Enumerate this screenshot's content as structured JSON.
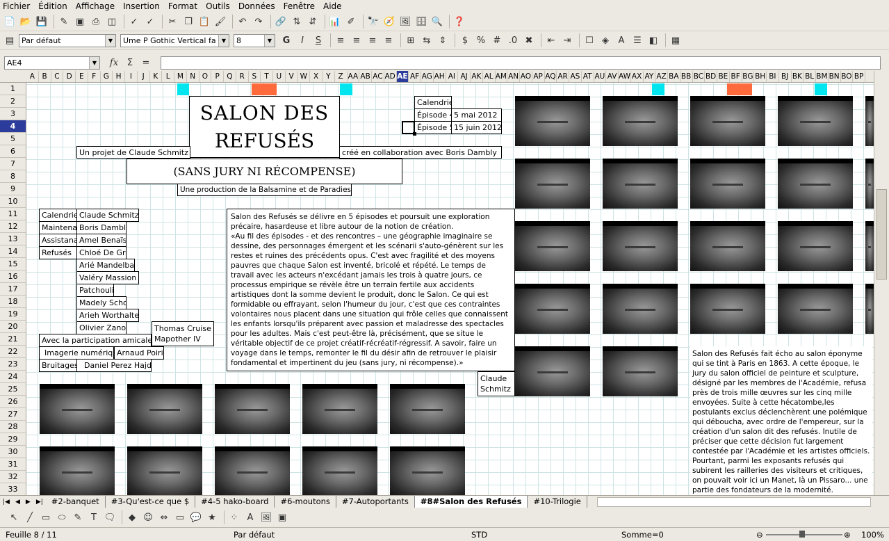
{
  "menu": [
    "Fichier",
    "Édition",
    "Affichage",
    "Insertion",
    "Format",
    "Outils",
    "Données",
    "Fenêtre",
    "Aide"
  ],
  "format_toolbar": {
    "style": "Par défaut",
    "font": "Ume P Gothic Vertical fa",
    "size": "8"
  },
  "formula_bar": {
    "cell_ref": "AE4",
    "content": ""
  },
  "columns": [
    "A",
    "B",
    "C",
    "D",
    "E",
    "F",
    "G",
    "H",
    "I",
    "J",
    "K",
    "L",
    "M",
    "N",
    "O",
    "P",
    "Q",
    "R",
    "S",
    "T",
    "U",
    "V",
    "W",
    "X",
    "Y",
    "Z",
    "AA",
    "AB",
    "AC",
    "AD",
    "AE",
    "AF",
    "AG",
    "AH",
    "AI",
    "AJ",
    "AK",
    "AL",
    "AM",
    "AN",
    "AO",
    "AP",
    "AQ",
    "AR",
    "AS",
    "AT",
    "AU",
    "AV",
    "AW",
    "AX",
    "AY",
    "AZ",
    "BA",
    "BB",
    "BC",
    "BD",
    "BE",
    "BF",
    "BG",
    "BH",
    "BI",
    "BJ",
    "BK",
    "BL",
    "BM",
    "BN",
    "BO",
    "BP"
  ],
  "selected_column": "AE",
  "rows": [
    "1",
    "2",
    "3",
    "4",
    "5",
    "6",
    "7",
    "8",
    "9",
    "10",
    "11",
    "12",
    "13",
    "14",
    "15",
    "16",
    "17",
    "18",
    "19",
    "20",
    "21",
    "22",
    "23",
    "24",
    "25",
    "26",
    "27",
    "28",
    "29",
    "30",
    "31",
    "32",
    "33"
  ],
  "selected_row": "4",
  "sheet": {
    "title_line1": "SALON DES",
    "title_line2": "REFUSÉS",
    "subtitle": "(SANS JURY NI RÉCOMPENSE)",
    "project_by": "Un projet de Claude Schmitz",
    "collab": "créé en collaboration avec Boris Dambly",
    "production": "Une production de la Balsamine et de Paradies.",
    "calendar": {
      "header": "Calendrier",
      "rows": [
        [
          "Épisode 4",
          "5 mai 2012"
        ],
        [
          "Épisode 5",
          "15 juin 2012"
        ]
      ]
    },
    "credits": [
      [
        "Calendrier",
        "Claude Schmitz"
      ],
      [
        "Maintenance",
        "Boris Dambly"
      ],
      [
        "Assistanat",
        "Amel Benaïssa"
      ],
      [
        "Refusés",
        "Chloé De Grom"
      ],
      [
        "",
        "Arié Mandelbaum"
      ],
      [
        "",
        "Valéry Massion"
      ],
      [
        "",
        "Patchouli"
      ],
      [
        "",
        "Madely Schott"
      ],
      [
        "",
        "Arieh Worthalter"
      ],
      [
        "",
        "Olivier Zanotti"
      ]
    ],
    "extra_name_line1": "Thomas Cruise",
    "extra_name_line2": "Mapother IV",
    "participation": "Avec la participation amicale de",
    "imagerie_label": "Imagerie numérique",
    "imagerie_name": "Arnaud Poirier",
    "bruitages_label": "Bruitages",
    "bruitages_name": "Daniel Perez Hajdu",
    "main_text": "Salon des Refusés se délivre en 5 épisodes et poursuit une exploration précaire, hasardeuse et libre autour de la notion de création.\n«Au fil des épisodes - et des rencontres – une géographie imaginaire se dessine, des personnages émergent et les scénarii s'auto-génèrent sur les restes et ruines des précédents opus. C'est avec fragilité et des moyens pauvres que chaque Salon est inventé, bricolé et répété. Le temps de travail avec les acteurs n'excédant jamais les trois à quatre jours, ce processus empirique se révèle être un terrain fertile aux accidents artistiques dont la somme devient le produit, donc le Salon. Ce qui est formidable ou effrayant, selon l'humeur du jour, c'est que ces contraintes volontaires nous placent dans une situation qui frôle celles que connaissent les enfants lorsqu'ils préparent avec passion et maladresse des spectacles pour les adultes. Mais c'est peut-être là, précisément, que se situe le véritable objectif de ce projet créatif-récréatif-régressif. A savoir, faire un voyage dans le temps, remonter le fil du désir afin de retrouver le plaisir fondamental et impertinent du jeu (sans jury, ni récompense).»",
    "signature_line1": "Claude",
    "signature_line2": "Schmitz",
    "side_text": "Salon des Refusés fait écho au salon éponyme qui se tint à Paris en 1863. A cette époque, le jury du salon officiel de peinture et sculpture, désigné par les membres de l'Académie, refusa près de trois mille œuvres sur les cinq mille envoyées. Suite à cette hécatombe,les postulants exclus déclenchèrent une polémique qui déboucha, avec ordre de l'empereur, sur la création d'un salon dit des refusés. Inutile de préciser que cette décision fut largement contestée par l'Académie et les artistes officiels. Pourtant, parmi les exposants refusés qui subirent les railleries des visiteurs et critiques, on pouvait voir ici un Manet, là un Pissaro... une partie des fondateurs de la modernité."
  },
  "tabs": [
    "#2-banquet",
    "#3-Qu'est-ce que $",
    "#4-5 hako-board",
    "#6-moutons",
    "#7-Autoportants",
    "#8#Salon des Refusés",
    "#10-Trilogie"
  ],
  "active_tab": "#8#Salon des Refusés",
  "status": {
    "sheet": "Feuille 8 / 11",
    "style": "Par défaut",
    "mode": "STD",
    "sum": "Somme=0",
    "zoom": "100%"
  },
  "colors": {
    "cyan": "#00e5ee",
    "orange": "#ff6a3d",
    "selection": "#2c3c9c"
  }
}
